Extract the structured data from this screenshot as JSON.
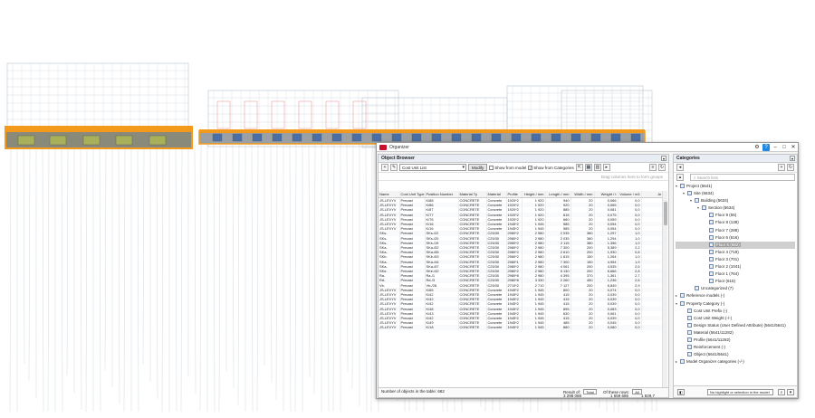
{
  "window": {
    "title": "Organizer"
  },
  "object_browser": {
    "title": "Object Browser",
    "property_set": "Cost Unit List",
    "modify_label": "Modify",
    "show_from_model": "Show from model",
    "show_from_categories": "Show from Categories",
    "group_hint": "Drag columns here to form groups",
    "columns": [
      "Name",
      "Cost Unit Type",
      "Position Number",
      "Material Ty",
      "Material",
      "Profile",
      "Height / mm",
      "Length / mm",
      "Width / mm",
      "Weight / t",
      "Volume / m3",
      "Ar"
    ],
    "rows": [
      [
        "JS-LEVYV",
        "Precast",
        "K/88",
        "CONCRETE",
        "Concrete",
        "1920*2",
        "1 920",
        "940",
        "20",
        "0,066",
        "0,0",
        ""
      ],
      [
        "JS-LEVYV",
        "Precast",
        "K/86",
        "CONCRETE",
        "Concrete",
        "1920*2",
        "1 920",
        "920",
        "20",
        "0,065",
        "0,0",
        ""
      ],
      [
        "JS-LEVYV",
        "Precast",
        "K/87",
        "CONCRETE",
        "Concrete",
        "1920*2",
        "1 920",
        "885",
        "20",
        "0,081",
        "0,0",
        ""
      ],
      [
        "JS-LEVYV",
        "Precast",
        "K/77",
        "CONCRETE",
        "Concrete",
        "1920*2",
        "1 920",
        "815",
        "20",
        "0,075",
        "0,0",
        ""
      ],
      [
        "JS-LEVYV",
        "Precast",
        "K/76",
        "CONCRETE",
        "Concrete",
        "1920*2",
        "1 920",
        "660",
        "20",
        "0,059",
        "0,0",
        ""
      ],
      [
        "JS-LEVYV",
        "Precast",
        "K/16",
        "CONCRETE",
        "Concrete",
        "1945*2",
        "1 945",
        "585",
        "20",
        "0,054",
        "0,0",
        ""
      ],
      [
        "JS-LEVYV",
        "Precast",
        "K/16",
        "CONCRETE",
        "Concrete",
        "1945*2",
        "1 945",
        "585",
        "20",
        "0,054",
        "0,0",
        ""
      ],
      [
        "SKs-",
        "Precast",
        "SKs-/22",
        "CONCRETE",
        "C25/30",
        "2980*2",
        "2 980",
        "2 035",
        "380",
        "1,297",
        "1,0",
        ""
      ],
      [
        "SKs-",
        "Precast",
        "SKs-/20",
        "CONCRETE",
        "C25/30",
        "2980*2",
        "2 980",
        "2 035",
        "380",
        "1,294",
        "1,0",
        ""
      ],
      [
        "SKs-",
        "Precast",
        "SKs-/19",
        "CONCRETE",
        "C25/30",
        "2980*2",
        "2 980",
        "2 115",
        "380",
        "1,356",
        "1,0",
        ""
      ],
      [
        "SKa-",
        "Precast",
        "SKa-/52",
        "CONCRETE",
        "C25/30",
        "2980*2",
        "2 980",
        "7 300",
        "200",
        "5,389",
        "2,2",
        ""
      ],
      [
        "SKa-",
        "Precast",
        "SKa-/65",
        "CONCRETE",
        "C25/30",
        "2980*2",
        "2 980",
        "2 610",
        "200",
        "1,930",
        "0,8",
        ""
      ],
      [
        "SKb-",
        "Precast",
        "SKb-/63",
        "CONCRETE",
        "C25/30",
        "2980*2",
        "2 980",
        "1 815",
        "150",
        "1,264",
        "1,0",
        ""
      ],
      [
        "SKa-",
        "Precast",
        "SKa-/44",
        "CONCRETE",
        "C25/30",
        "2980*1",
        "2 980",
        "7 300",
        "150",
        "4,954",
        "1,9",
        ""
      ],
      [
        "SKa-",
        "Precast",
        "SKa-/67",
        "CONCRETE",
        "C25/30",
        "2980*2",
        "2 980",
        "4 061",
        "200",
        "4,535",
        "2,6",
        ""
      ],
      [
        "SKe-",
        "Precast",
        "SKe-/42",
        "CONCRETE",
        "C25/30",
        "2980*2",
        "2 980",
        "5 130",
        "200",
        "6,666",
        "2,8",
        ""
      ],
      [
        "Ra-",
        "Precast",
        "Ra-/1",
        "CONCRETE",
        "C25/30",
        "2980*8",
        "2 980",
        "4 395",
        "370",
        "1,361",
        "2,7",
        ""
      ],
      [
        "Rd-",
        "Precast",
        "Rd-/3",
        "CONCRETE",
        "C25/30",
        "2980*8",
        "3 330",
        "2 260",
        "450",
        "1,236",
        "2,6",
        ""
      ],
      [
        "Vb-",
        "Precast",
        "Vb-/28",
        "CONCRETE",
        "C25/30",
        "2710*2",
        "2 710",
        "7 127",
        "200",
        "6,849",
        "2,9",
        ""
      ],
      [
        "JS-LEVYV",
        "Precast",
        "K/65",
        "CONCRETE",
        "Concrete",
        "1945*2",
        "1 945",
        "800",
        "20",
        "0,074",
        "0,0",
        ""
      ],
      [
        "JS-LEVYV",
        "Precast",
        "K/42",
        "CONCRETE",
        "Concrete",
        "1945*2",
        "1 945",
        "415",
        "20",
        "0,039",
        "0,0",
        ""
      ],
      [
        "JS-LEVYV",
        "Precast",
        "K/42",
        "CONCRETE",
        "Concrete",
        "1945*2",
        "1 945",
        "415",
        "20",
        "0,039",
        "0,0",
        ""
      ],
      [
        "JS-LEVYV",
        "Precast",
        "K/42",
        "CONCRETE",
        "Concrete",
        "1945*2",
        "1 945",
        "415",
        "20",
        "0,039",
        "0,0",
        ""
      ],
      [
        "JS-LEVYV",
        "Precast",
        "K/48",
        "CONCRETE",
        "Concrete",
        "1945*2",
        "1 945",
        "895",
        "20",
        "0,083",
        "0,0",
        ""
      ],
      [
        "JS-LEVYV",
        "Precast",
        "K/43",
        "CONCRETE",
        "Concrete",
        "1945*2",
        "1 945",
        "630",
        "20",
        "0,061",
        "0,0",
        ""
      ],
      [
        "JS-LEVYV",
        "Precast",
        "K/42",
        "CONCRETE",
        "Concrete",
        "1945*2",
        "1 945",
        "415",
        "20",
        "0,039",
        "0,0",
        ""
      ],
      [
        "JS-LEVYV",
        "Precast",
        "K/49",
        "CONCRETE",
        "Concrete",
        "1945*2",
        "1 945",
        "485",
        "20",
        "0,045",
        "0,0",
        ""
      ],
      [
        "JS-LEVYV",
        "Precast",
        "K/18",
        "CONCRETE",
        "Concrete",
        "1945*2",
        "1 945",
        "880",
        "20",
        "0,080",
        "0,0",
        ""
      ]
    ],
    "footer": {
      "count_label": "Number of objects in the table:",
      "count": "682",
      "result_label": "Result of:",
      "result_value": "Total",
      "show_label": "Of these rows:",
      "show_value": "All",
      "totals": [
        "3 298 088",
        "1 659 686",
        "1 829,7"
      ]
    }
  },
  "categories": {
    "title": "Categories",
    "search_placeholder": "Search lists",
    "tree": [
      {
        "label": "Project (5641)",
        "depth": 0,
        "arrow": "▾"
      },
      {
        "label": "Site (5634)",
        "depth": 1,
        "arrow": "▾"
      },
      {
        "label": "Building (5634)",
        "depth": 2,
        "arrow": "▾"
      },
      {
        "label": "Section (5634)",
        "depth": 3,
        "arrow": "▾"
      },
      {
        "label": "Floor 9 (55)",
        "depth": 4,
        "arrow": ""
      },
      {
        "label": "Floor 8 (138)",
        "depth": 4,
        "arrow": ""
      },
      {
        "label": "Floor 7 (288)",
        "depth": 4,
        "arrow": ""
      },
      {
        "label": "Floor 6 (616)",
        "depth": 4,
        "arrow": ""
      },
      {
        "label": "Floor 5 (682)",
        "depth": 4,
        "arrow": "",
        "selected": true
      },
      {
        "label": "Floor 4 (719)",
        "depth": 4,
        "arrow": ""
      },
      {
        "label": "Floor 3 (701)",
        "depth": 4,
        "arrow": ""
      },
      {
        "label": "Floor 2 (1041)",
        "depth": 4,
        "arrow": ""
      },
      {
        "label": "Floor 1 (764)",
        "depth": 4,
        "arrow": ""
      },
      {
        "label": "Floor (615)",
        "depth": 4,
        "arrow": ""
      },
      {
        "label": "Uncategorized (7)",
        "depth": 2,
        "arrow": ""
      },
      {
        "label": "Reference models (-)",
        "depth": 0,
        "arrow": "▸"
      },
      {
        "label": "Property Category (-)",
        "depth": 0,
        "arrow": "▾"
      },
      {
        "label": "Cost Unit Prefix (-)",
        "depth": 1,
        "arrow": ""
      },
      {
        "label": "Cost Unit Weight (-/-)",
        "depth": 1,
        "arrow": ""
      },
      {
        "label": "Design Status (User Defined Attribute) (5641/5641)",
        "depth": 1,
        "arrow": ""
      },
      {
        "label": "Material (5641/11282)",
        "depth": 1,
        "arrow": ""
      },
      {
        "label": "Profile (5641/11282)",
        "depth": 1,
        "arrow": ""
      },
      {
        "label": "Reinforcement (-)",
        "depth": 1,
        "arrow": ""
      },
      {
        "label": "Object (5641/5641)",
        "depth": 1,
        "arrow": ""
      },
      {
        "label": "Model Organizer categories (-/-)",
        "depth": 0,
        "arrow": "▸"
      }
    ],
    "footer_select": "No highlight or selection in the model"
  }
}
